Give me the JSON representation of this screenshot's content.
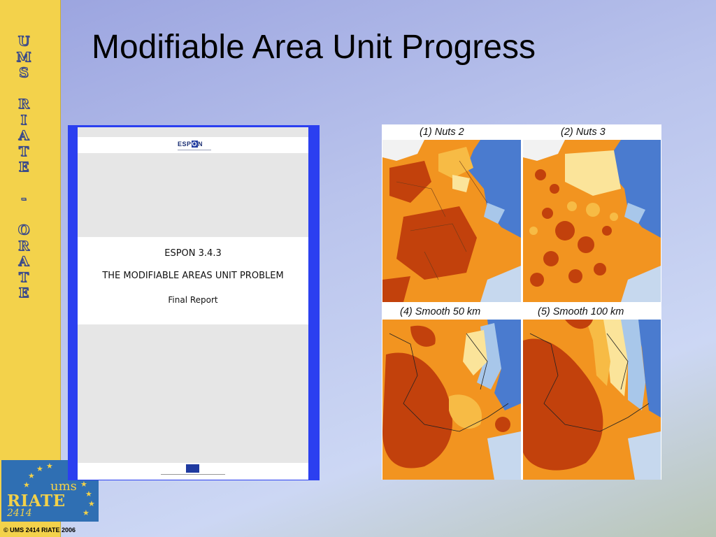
{
  "slide": {
    "title": "Modifiable Area Unit Progress",
    "sidebar_letters": [
      "U",
      "M",
      "S",
      "",
      "R",
      "I",
      "A",
      "T",
      "E",
      "",
      "-",
      "",
      "O",
      "R",
      "A",
      "T",
      "E"
    ],
    "logo": {
      "top": "ums",
      "main": "RIATE",
      "number": "2414"
    },
    "copyright": "© UMS 2414 RIATE 2006"
  },
  "report": {
    "logo_text_pre": "ESP",
    "logo_text_o": "O",
    "logo_text_post": "N",
    "line1": "ESPON 3.4.3",
    "line2": "THE MODIFIABLE AREAS UNIT PROBLEM",
    "line3": "Final Report"
  },
  "maps": {
    "labels": [
      "(1) Nuts 2",
      "(2) Nuts 3",
      "(4) Smooth 50 km",
      "(5) Smooth 100 km"
    ]
  },
  "colors": {
    "sidebar_yellow": "#f3d24b",
    "report_border_blue": "#2b3ff0",
    "map_dark_red": "#c2410c",
    "map_orange": "#f29420",
    "map_light_orange": "#f7bb45",
    "map_yellow": "#fbe49a",
    "map_blue": "#4a7bcf",
    "map_light_blue": "#a8c7ea"
  }
}
